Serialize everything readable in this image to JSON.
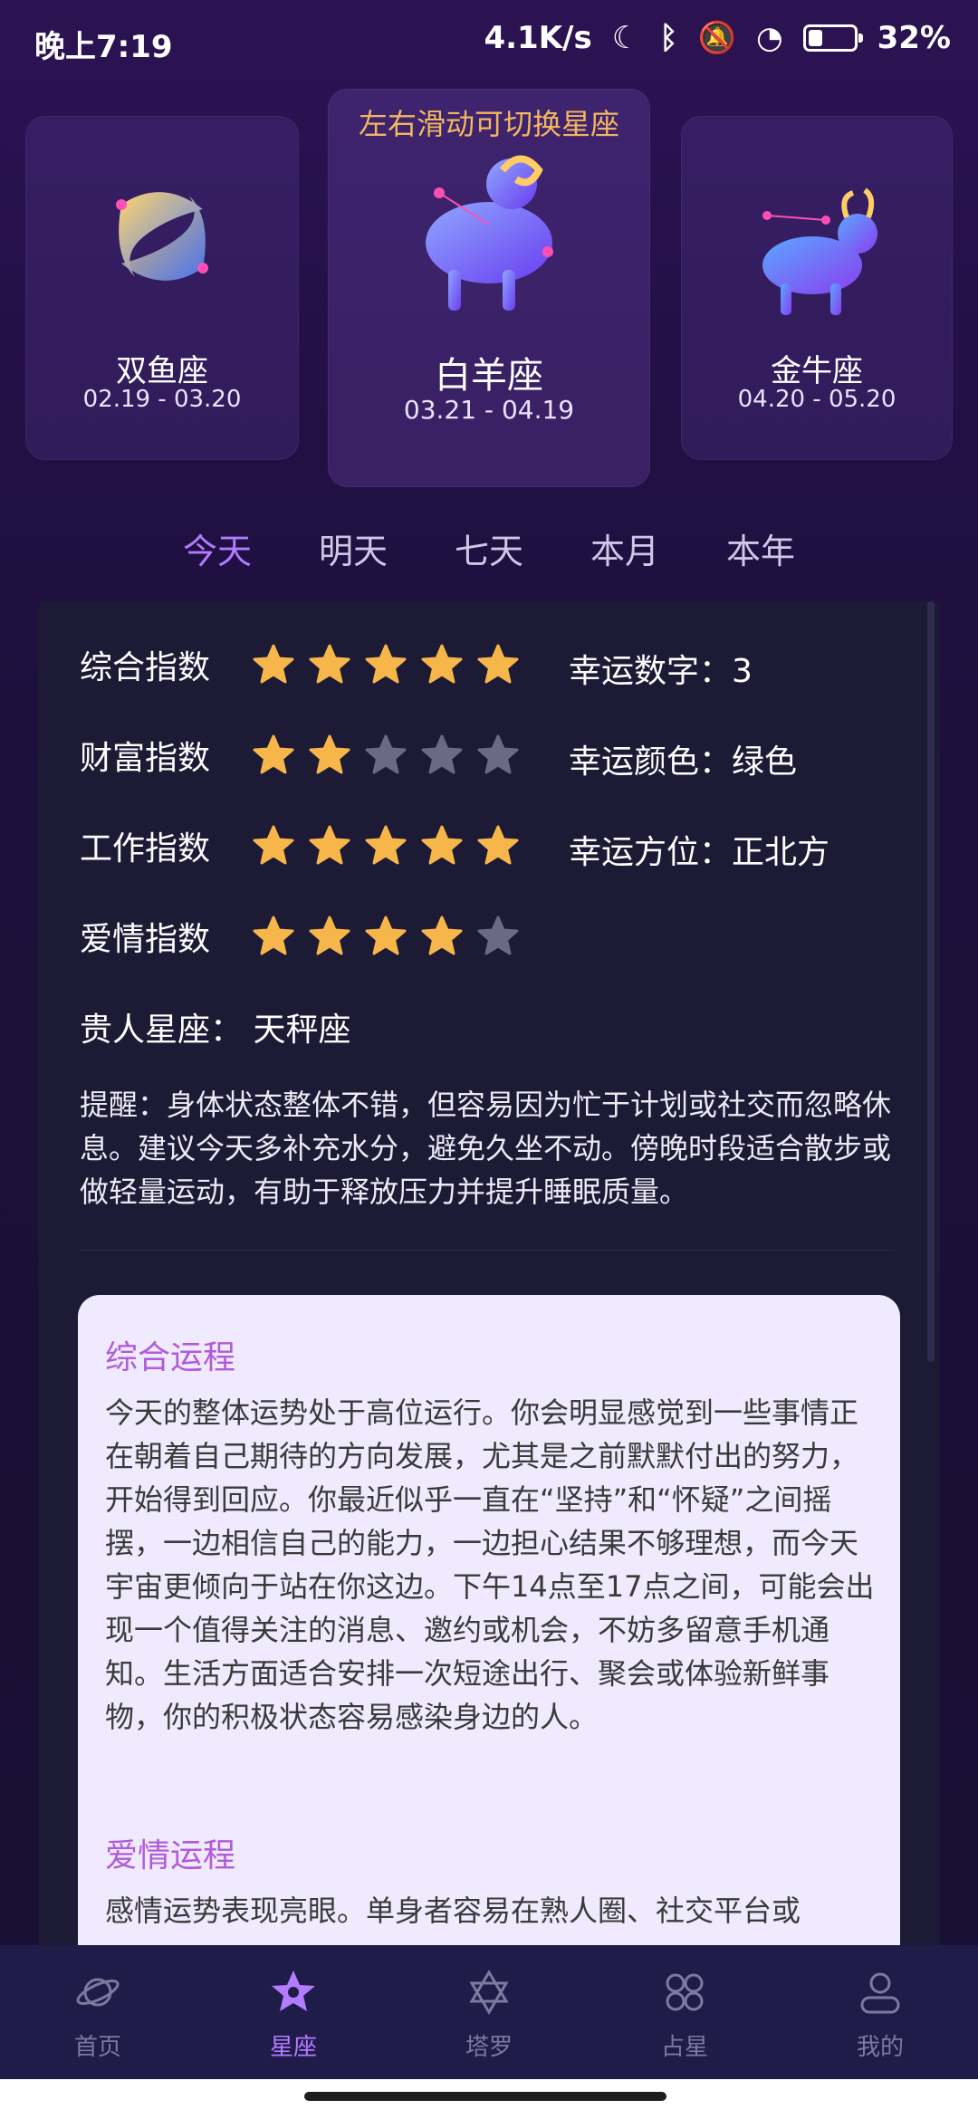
{
  "status": {
    "time": "晚上7:19",
    "speed": "4.1K/s",
    "battery": "32%",
    "battery_level": 0.32
  },
  "zodiac": {
    "hint": "左右滑动可切换星座",
    "left": {
      "name": "双鱼座",
      "date": "02.19 - 03.20"
    },
    "center": {
      "name": "白羊座",
      "date": "03.21 - 04.19"
    },
    "right": {
      "name": "金牛座",
      "date": "04.20 - 05.20"
    }
  },
  "tabs": [
    "今天",
    "明天",
    "七天",
    "本月",
    "本年"
  ],
  "indices": [
    {
      "label": "综合指数",
      "stars": 5
    },
    {
      "label": "财富指数",
      "stars": 2
    },
    {
      "label": "工作指数",
      "stars": 5
    },
    {
      "label": "爱情指数",
      "stars": 4
    }
  ],
  "luck": {
    "number": "幸运数字：3",
    "color": "幸运颜色：绿色",
    "direction": "幸运方位：正北方"
  },
  "guiren": "贵人星座：   天秤座",
  "reminder": "提醒：身体状态整体不错，但容易因为忙于计划或社交而忽略休息。建议今天多补充水分，避免久坐不动。傍晚时段适合散步或做轻量运动，有助于释放压力并提升睡眠质量。",
  "fortune": {
    "general_title": "综合运程",
    "general_text": "今天的整体运势处于高位运行。你会明显感觉到一些事情正在朝着自己期待的方向发展，尤其是之前默默付出的努力，开始得到回应。你最近似乎一直在“坚持”和“怀疑”之间摇摆，一边相信自己的能力，一边担心结果不够理想，而今天宇宙更倾向于站在你这边。下午14点至17点之间，可能会出现一个值得关注的消息、邀约或机会，不妨多留意手机通知。生活方面适合安排一次短途出行、聚会或体验新鲜事物，你的积极状态容易感染身边的人。",
    "love_title": "爱情运程",
    "love_text": "感情运势表现亮眼。单身者容易在熟人圈、社交平台或"
  },
  "nav": [
    {
      "label": "首页",
      "icon": "planet-icon"
    },
    {
      "label": "星座",
      "icon": "star-icon"
    },
    {
      "label": "塔罗",
      "icon": "hexagram-icon"
    },
    {
      "label": "占星",
      "icon": "astro-icon"
    },
    {
      "label": "我的",
      "icon": "user-icon"
    }
  ],
  "colors": {
    "accent": "#b17bff",
    "star_on": "#f7b64a",
    "star_off": "#6b6a84",
    "hint": "#f2b760"
  }
}
